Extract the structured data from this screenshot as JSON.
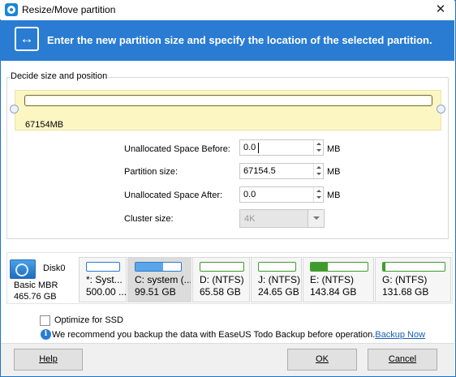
{
  "window": {
    "title": "Resize/Move partition",
    "close_glyph": "✕"
  },
  "banner": {
    "icon": "resize-arrows-icon",
    "icon_glyph": "↔",
    "text": "Enter the new partition size and specify the location of the selected partition."
  },
  "group": {
    "legend": "Decide size and position",
    "slider_size_label": "67154MB"
  },
  "form": {
    "before_label": "Unallocated Space Before:",
    "before_value": "0.0",
    "size_label": "Partition size:",
    "size_value": "67154.5",
    "after_label": "Unallocated Space After:",
    "after_value": "0.0",
    "unit": "MB",
    "cluster_label": "Cluster size:",
    "cluster_value": "4K"
  },
  "disk": {
    "name": "Disk0",
    "type": "Basic MBR",
    "size": "465.76 GB",
    "partitions": [
      {
        "name": "*: Syst...",
        "capacity": "500.00 ...",
        "used_fraction": 0.0,
        "color": "#2b7ad0"
      },
      {
        "name": "C: system (...",
        "capacity": "99.51 GB",
        "used_fraction": 0.6,
        "color": "#5aa6e8"
      },
      {
        "name": "D: (NTFS)",
        "capacity": "65.58 GB",
        "used_fraction": 0.0,
        "color": "#3f9c2c"
      },
      {
        "name": "J: (NTFS)",
        "capacity": "24.65 GB",
        "used_fraction": 0.0,
        "color": "#3f9c2c"
      },
      {
        "name": "E: (NTFS)",
        "capacity": "143.84 GB",
        "used_fraction": 0.3,
        "color": "#3f9c2c"
      },
      {
        "name": "G: (NTFS)",
        "capacity": "131.68 GB",
        "used_fraction": 0.04,
        "color": "#3f9c2c"
      }
    ]
  },
  "options": {
    "ssd_label": "Optimize for SSD",
    "ssd_checked": false,
    "info_glyph": "i",
    "recommend_text": "We recommend you backup the data with EaseUS Todo Backup before operation.",
    "backup_link": "Backup Now"
  },
  "footer": {
    "help": "Help",
    "ok": "OK",
    "cancel": "Cancel"
  },
  "colors": {
    "banner": "#2a7cd3",
    "slider_background": "#fcf6c3",
    "selected_partition": "#dcdcdc"
  }
}
